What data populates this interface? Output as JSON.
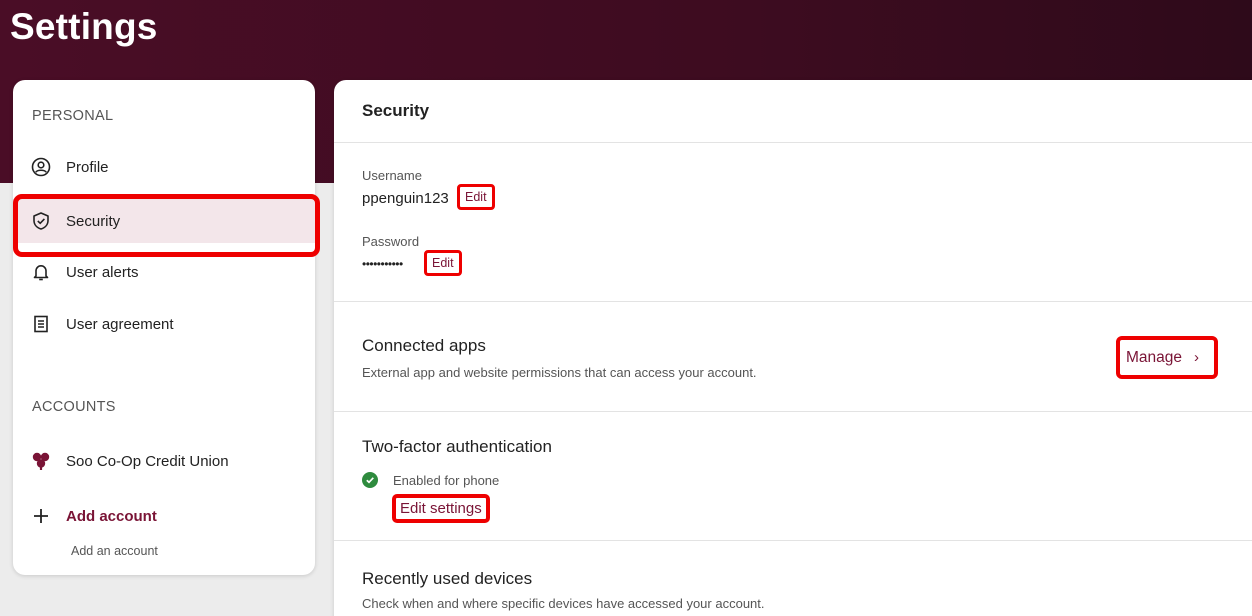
{
  "page": {
    "title": "Settings"
  },
  "sidebar": {
    "personal_header": "PERSONAL",
    "items": [
      {
        "label": "Profile",
        "icon": "profile-icon"
      },
      {
        "label": "Security",
        "icon": "shield-icon",
        "active": true
      },
      {
        "label": "User alerts",
        "icon": "bell-icon"
      },
      {
        "label": "User agreement",
        "icon": "document-icon"
      }
    ],
    "accounts_header": "ACCOUNTS",
    "accounts": [
      {
        "label": "Soo Co-Op Credit Union",
        "icon": "credit-union-logo-icon"
      }
    ],
    "add_account": {
      "label": "Add account",
      "sub": "Add an account"
    }
  },
  "main": {
    "title": "Security",
    "username": {
      "label": "Username",
      "value": "ppenguin123",
      "edit": "Edit"
    },
    "password": {
      "label": "Password",
      "value": "•••••••••••",
      "edit": "Edit"
    },
    "connected_apps": {
      "title": "Connected apps",
      "desc": "External app and website permissions that can access your account.",
      "manage": "Manage"
    },
    "two_factor": {
      "title": "Two-factor authentication",
      "status": "Enabled for phone",
      "edit_settings": "Edit settings"
    },
    "recent_devices": {
      "title": "Recently used devices",
      "desc": "Check when and where specific devices have accessed your account."
    }
  },
  "colors": {
    "brand": "#7a1436",
    "header": "#3d0c20",
    "highlight": "#ee0000",
    "success": "#2e8b3e"
  }
}
